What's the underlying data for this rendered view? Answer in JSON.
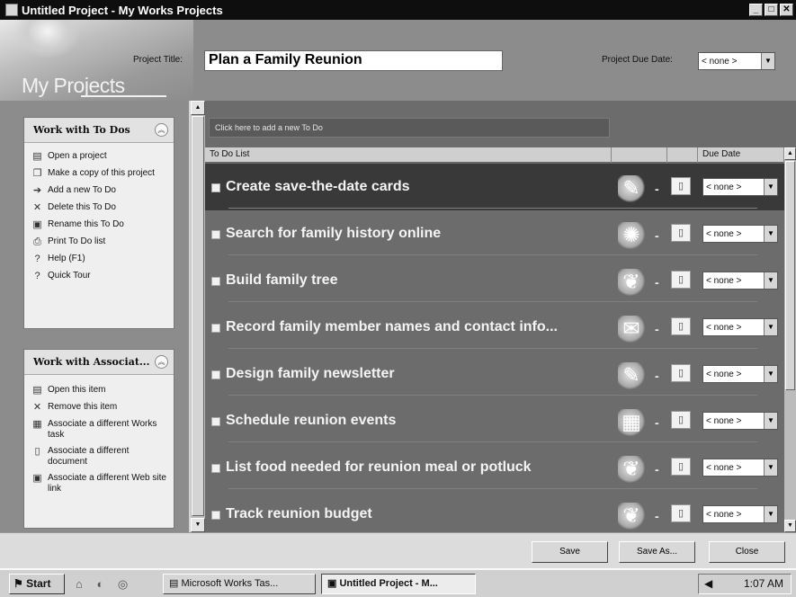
{
  "window": {
    "title": "Untitled Project - My Works Projects",
    "controls": [
      "_",
      "□",
      "✕"
    ]
  },
  "header": {
    "logo_text": "My Projects",
    "project_title_label": "Project Title:",
    "project_title_value": "Plan a Family Reunion",
    "due_date_label": "Project Due Date:",
    "due_date_value": "< none >"
  },
  "left_panel": {
    "todos_box": {
      "title": "Work with To Dos",
      "items": [
        {
          "label": "Open a project",
          "icon": "open-project-icon",
          "glyph": "▤"
        },
        {
          "label": "Make a copy of this project",
          "icon": "copy-icon",
          "glyph": "❐"
        },
        {
          "label": "Add a new To Do",
          "icon": "add-arrow-icon",
          "glyph": "➔"
        },
        {
          "label": "Delete this To Do",
          "icon": "delete-x-icon",
          "glyph": "✕"
        },
        {
          "label": "Rename this To Do",
          "icon": "rename-icon",
          "glyph": "▣"
        },
        {
          "label": "Print To Do list",
          "icon": "print-icon",
          "glyph": "⎙"
        },
        {
          "label": "Help (F1)",
          "icon": "help-icon",
          "glyph": "?"
        },
        {
          "label": "Quick Tour",
          "icon": "tour-icon",
          "glyph": "?"
        }
      ]
    },
    "assoc_box": {
      "title": "Work with Associat...",
      "items": [
        {
          "label": "Open this item",
          "icon": "open-item-icon",
          "glyph": "▤"
        },
        {
          "label": "Remove this item",
          "icon": "remove-x-icon",
          "glyph": "✕"
        },
        {
          "label": "Associate a different Works task",
          "icon": "works-task-icon",
          "glyph": "▦"
        },
        {
          "label": "Associate a different document",
          "icon": "document-icon",
          "glyph": "▯"
        },
        {
          "label": "Associate a different Web site link",
          "icon": "web-link-icon",
          "glyph": "▣"
        }
      ]
    }
  },
  "main": {
    "add_todo_text": "Click here to add a new To Do",
    "columns": {
      "todo_list": "To Do List",
      "due_date": "Due Date"
    },
    "todos": [
      {
        "text": "Create save-the-date cards",
        "due": "< none >",
        "icon": "card-icon",
        "glyph": "✎",
        "selected": true
      },
      {
        "text": "Search for family history online",
        "due": "< none >",
        "icon": "globe-photo-icon",
        "glyph": "✺",
        "selected": false
      },
      {
        "text": "Build family tree",
        "due": "< none >",
        "icon": "tree-icon",
        "glyph": "❦",
        "selected": false
      },
      {
        "text": "Record family member names and contact info...",
        "due": "< none >",
        "icon": "contacts-icon",
        "glyph": "✉",
        "selected": false
      },
      {
        "text": "Design family newsletter",
        "due": "< none >",
        "icon": "newsletter-icon",
        "glyph": "✎",
        "selected": false
      },
      {
        "text": "Schedule reunion events",
        "due": "< none >",
        "icon": "calendar-icon",
        "glyph": "▦",
        "selected": false
      },
      {
        "text": "List food needed for reunion meal or potluck",
        "due": "< none >",
        "icon": "food-icon",
        "glyph": "❦",
        "selected": false
      },
      {
        "text": "Track reunion budget",
        "due": "< none >",
        "icon": "budget-icon",
        "glyph": "❦",
        "selected": false
      }
    ]
  },
  "buttons": {
    "save": "Save",
    "save_as": "Save As...",
    "close": "Close"
  },
  "taskbar": {
    "start": "Start",
    "quick_launch": "⌂ ◐ ◎",
    "tasks": [
      {
        "label": "Microsoft Works Tas...",
        "active": false
      },
      {
        "label": "Untitled Project - M...",
        "active": true
      }
    ],
    "time": "1:07 AM"
  }
}
